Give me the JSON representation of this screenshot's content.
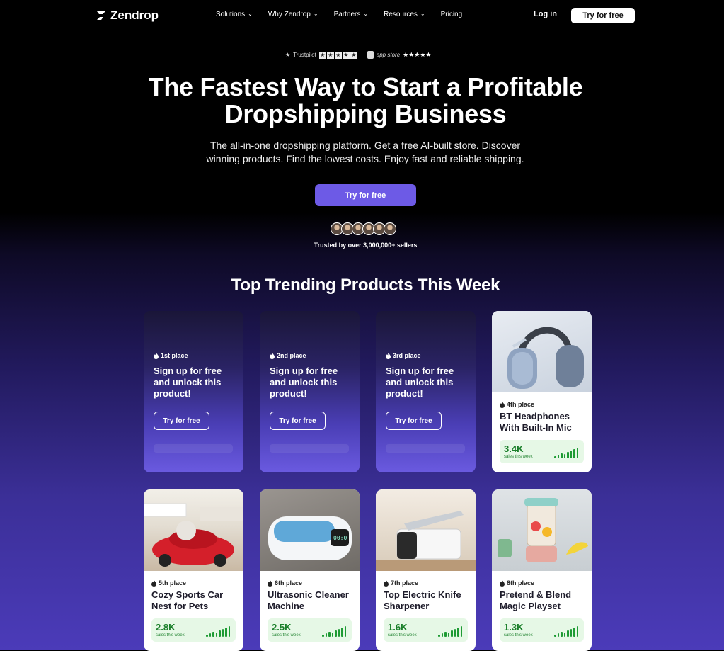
{
  "nav": {
    "brand": "Zendrop",
    "menu": [
      {
        "label": "Solutions"
      },
      {
        "label": "Why Zendrop"
      },
      {
        "label": "Partners"
      },
      {
        "label": "Resources"
      },
      {
        "label": "Pricing"
      }
    ],
    "login": "Log in",
    "cta": "Try for free"
  },
  "hero": {
    "trustpilot_label": "Trustpilot",
    "appstore_label": "app store",
    "title_line1": "The Fastest Way to Start a Profitable",
    "title_line2": "Dropshipping Business",
    "subtitle_line1": "The all-in-one dropshipping platform. Get a free AI-built store. Discover",
    "subtitle_line2": "winning products. Find the lowest costs. Enjoy fast and reliable shipping.",
    "cta": "Try for free",
    "trusted": "Trusted by over 3,000,000+ sellers"
  },
  "products": {
    "section_title": "Top Trending Products This Week",
    "locked_message": "Sign up for free and unlock this product!",
    "locked_cta": "Try for free",
    "locked": [
      {
        "place": "1st place"
      },
      {
        "place": "2nd place"
      },
      {
        "place": "3rd place"
      }
    ],
    "items": [
      {
        "place": "4th place",
        "name": "BT Headphones With Built-In Mic",
        "sales": "3.4K",
        "sales_label": "sales this week"
      },
      {
        "place": "5th place",
        "name": "Cozy Sports Car Nest for Pets",
        "sales": "2.8K",
        "sales_label": "sales this week"
      },
      {
        "place": "6th place",
        "name": "Ultrasonic Cleaner Machine",
        "sales": "2.5K",
        "sales_label": "sales this week"
      },
      {
        "place": "7th place",
        "name": "Top Electric Knife Sharpener",
        "sales": "1.6K",
        "sales_label": "sales this week"
      },
      {
        "place": "8th place",
        "name": "Pretend & Blend Magic Playset",
        "sales": "1.3K",
        "sales_label": "sales this week"
      }
    ]
  },
  "colors": {
    "accent": "#6d5ae6",
    "sales_green": "#1a7f2a",
    "sales_bg": "#e6f8e6"
  }
}
